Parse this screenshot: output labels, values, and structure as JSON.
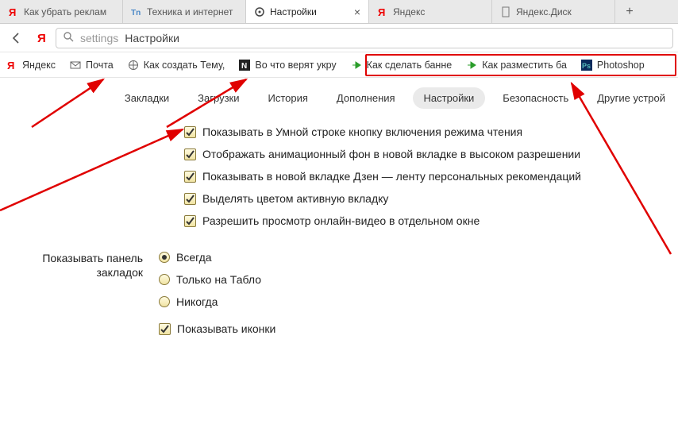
{
  "tabs": [
    {
      "label": "Как убрать реклам",
      "icon": "ya"
    },
    {
      "label": "Техника и интернет",
      "icon": "tn"
    },
    {
      "label": "Настройки",
      "icon": "gear",
      "active": true
    },
    {
      "label": "Яндекс",
      "icon": "ya"
    },
    {
      "label": "Яндекс.Диск",
      "icon": "doc"
    }
  ],
  "omnibox": {
    "keyword": "settings",
    "title": "Настройки"
  },
  "bookmarks": [
    {
      "label": "Яндекс",
      "icon": "ya"
    },
    {
      "label": "Почта",
      "icon": "mail"
    },
    {
      "label": "Как создать Тему,",
      "icon": "globe"
    },
    {
      "label": "Во что верят укру",
      "icon": "n"
    },
    {
      "label": "Как сделать банне",
      "icon": "arrow"
    },
    {
      "label": "Как разместить ба",
      "icon": "arrow"
    },
    {
      "label": "Photoshop",
      "icon": "ps"
    }
  ],
  "settings_nav": [
    {
      "label": "Закладки"
    },
    {
      "label": "Загрузки"
    },
    {
      "label": "История"
    },
    {
      "label": "Дополнения"
    },
    {
      "label": "Настройки",
      "active": true
    },
    {
      "label": "Безопасность"
    },
    {
      "label": "Другие устрой"
    }
  ],
  "options": [
    "Показывать в Умной строке кнопку включения режима чтения",
    "Отображать анимационный фон в новой вкладке в высоком разрешении",
    "Показывать в новой вкладке Дзен — ленту персональных рекомендаций",
    "Выделять цветом активную вкладку",
    "Разрешить просмотр онлайн-видео в отдельном окне"
  ],
  "bm_section": {
    "title_l1": "Показывать панель",
    "title_l2": "закладок",
    "radios": [
      "Всегда",
      "Только на Табло",
      "Никогда"
    ],
    "selected": 0,
    "check": "Показывать иконки"
  }
}
